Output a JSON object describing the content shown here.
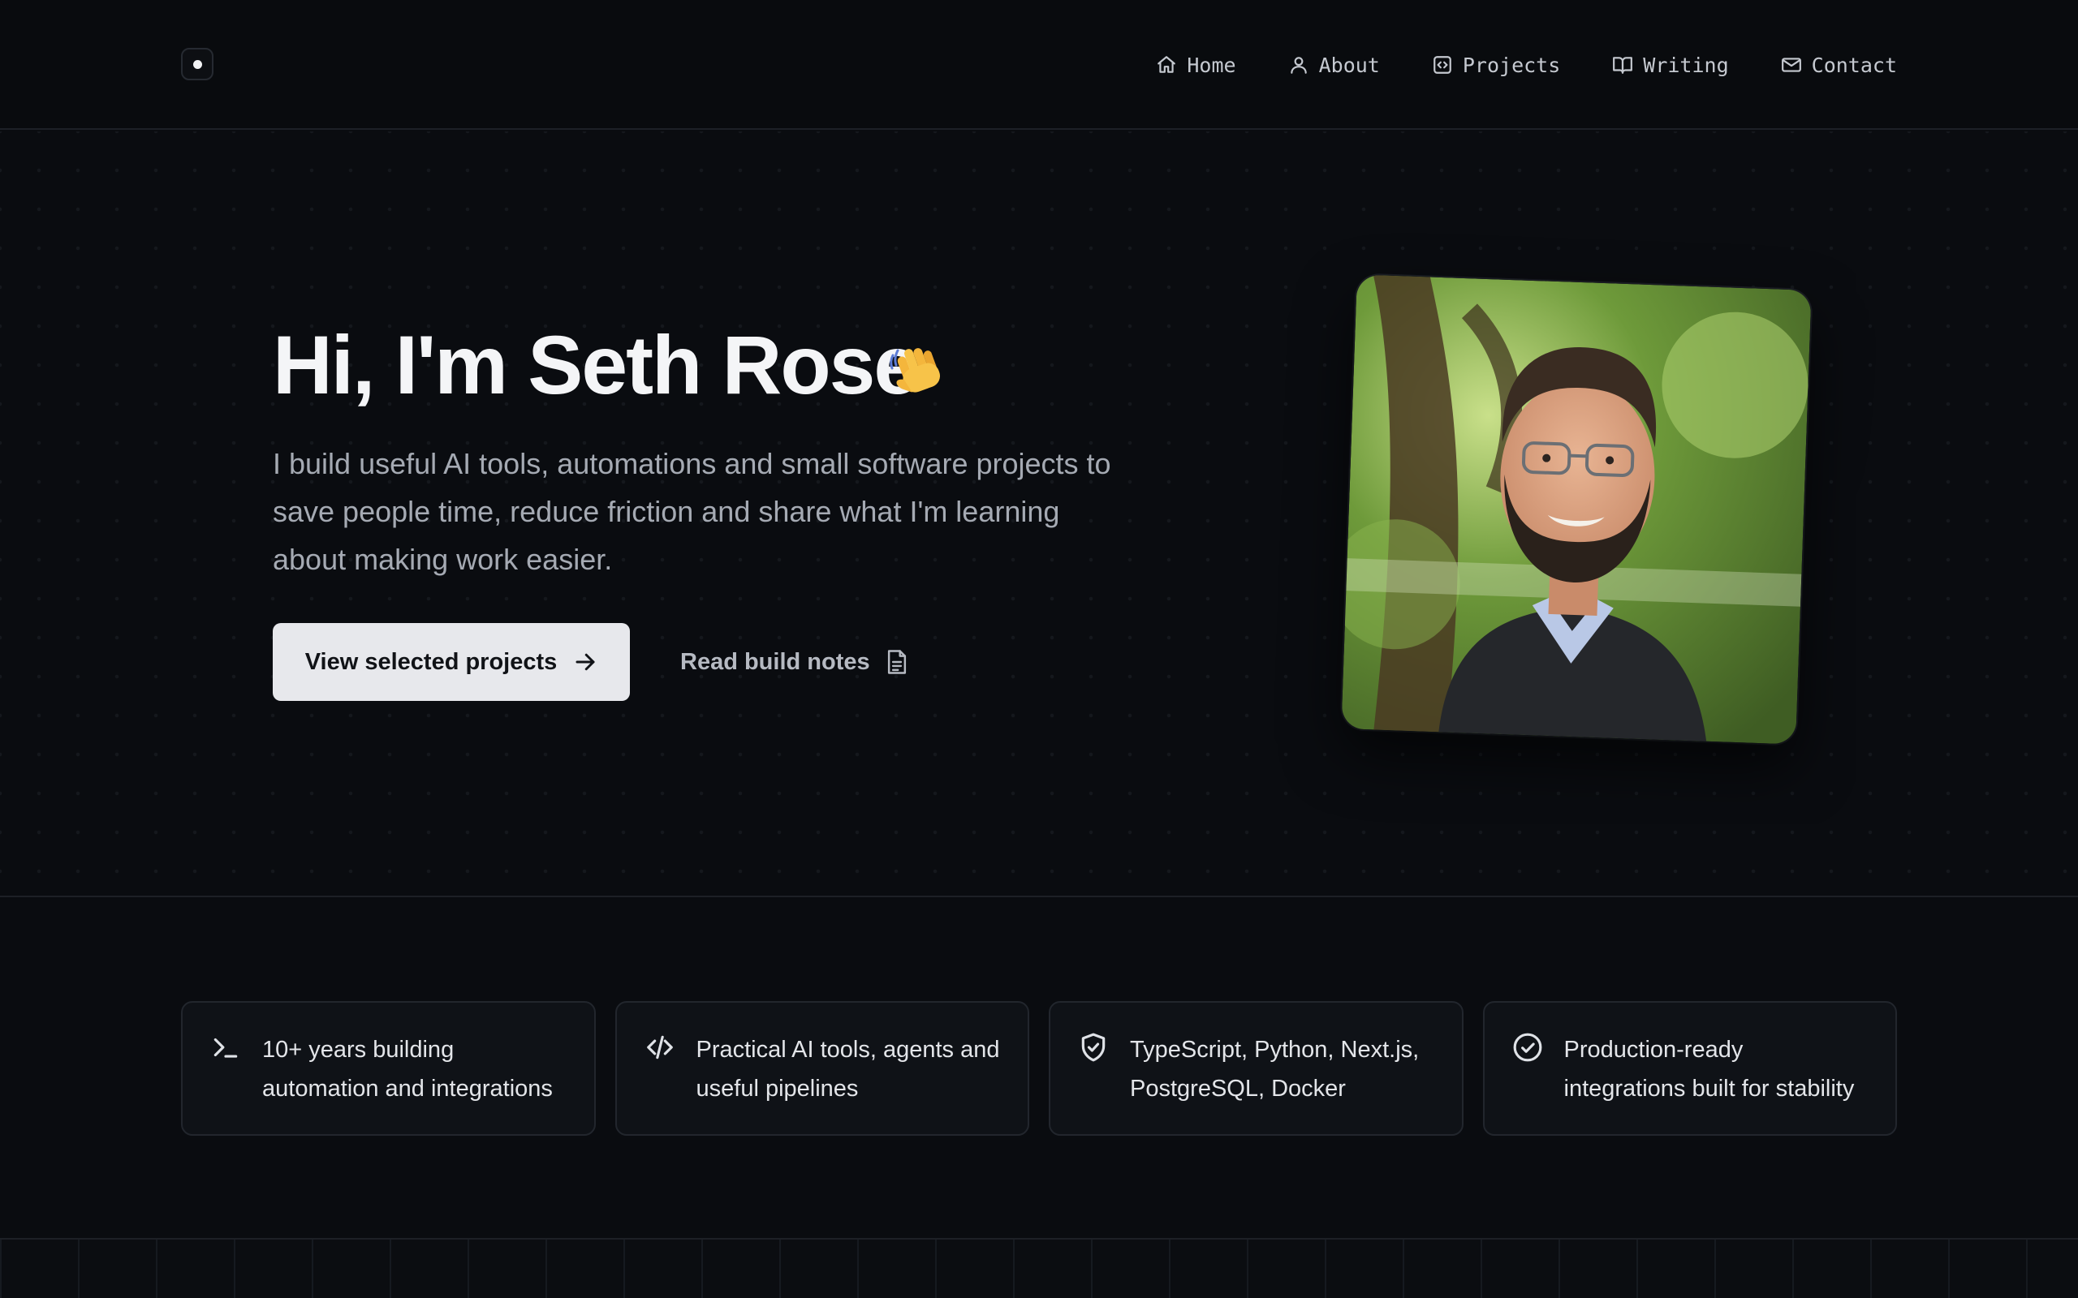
{
  "nav": {
    "items": [
      {
        "label": "Home",
        "icon": "home-icon"
      },
      {
        "label": "About",
        "icon": "user-icon"
      },
      {
        "label": "Projects",
        "icon": "code-square-icon"
      },
      {
        "label": "Writing",
        "icon": "book-open-icon"
      },
      {
        "label": "Contact",
        "icon": "mail-icon"
      }
    ]
  },
  "hero": {
    "title": "Hi, I'm Seth Rose",
    "wave_icon": "waving-hand-icon",
    "description": "I build useful AI tools, automations and small software projects to save people time, reduce friction and share what I'm learning about making work easier.",
    "primary_cta": "View selected projects",
    "secondary_cta": "Read build notes"
  },
  "features": [
    {
      "icon": "terminal-icon",
      "text": "10+ years building automation and integrations"
    },
    {
      "icon": "code-icon",
      "text": "Practical AI tools, agents and useful pipelines"
    },
    {
      "icon": "shield-check-icon",
      "text": "TypeScript, Python, Next.js, PostgreSQL, Docker"
    },
    {
      "icon": "check-circle-icon",
      "text": "Production-ready integrations built for stability"
    }
  ],
  "colors": {
    "background": "#0a0c10",
    "primary_button": "#e7e8ec",
    "muted_text": "#a5aab3"
  }
}
